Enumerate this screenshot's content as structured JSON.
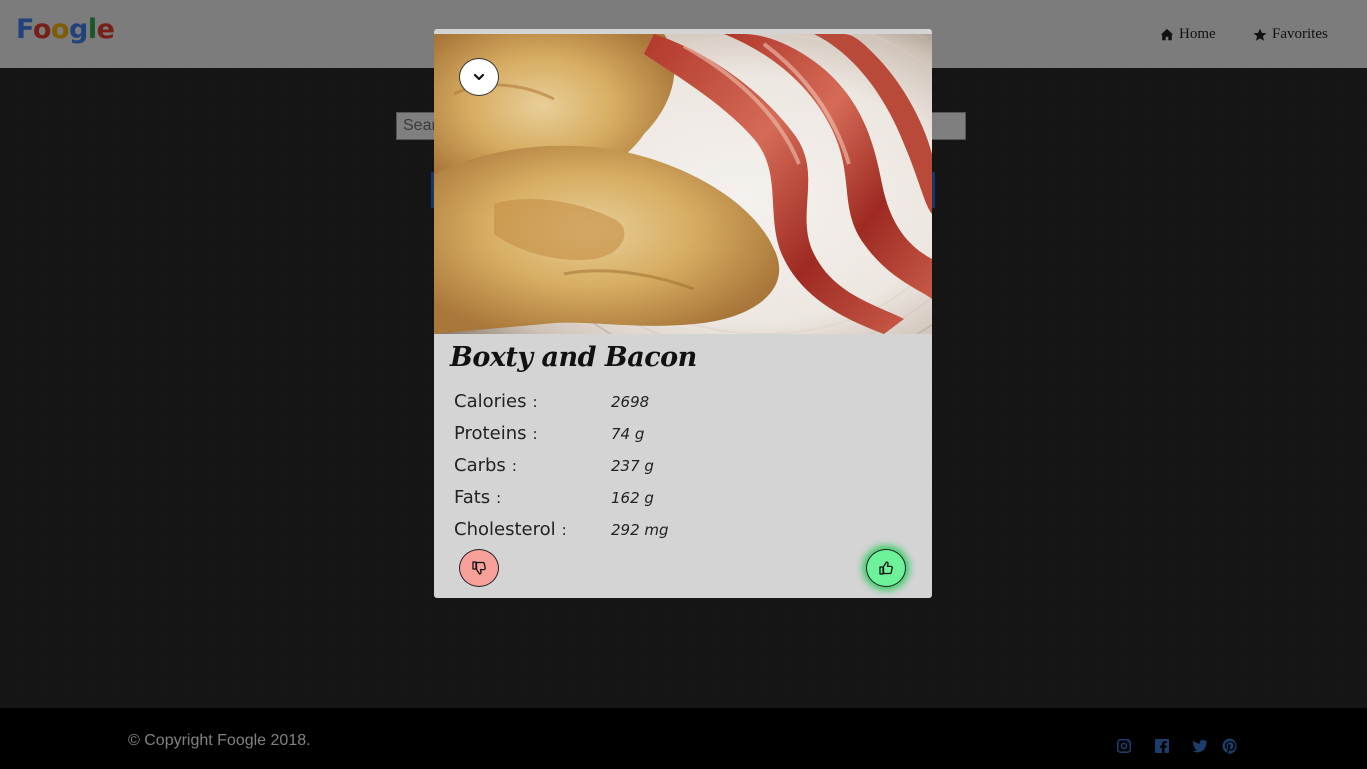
{
  "app": {
    "logo": "Foogle",
    "logo_letters": [
      {
        "char": "F",
        "color": "#4285f4"
      },
      {
        "char": "o",
        "color": "#ea4335"
      },
      {
        "char": "o",
        "color": "#fbbc05"
      },
      {
        "char": "g",
        "color": "#4285f4"
      },
      {
        "char": "l",
        "color": "#34a853"
      },
      {
        "char": "e",
        "color": "#ea4335"
      }
    ]
  },
  "nav": {
    "home": {
      "label": "Home",
      "icon": "home-icon"
    },
    "favorites": {
      "label": "Favorites",
      "icon": "star-icon"
    }
  },
  "search": {
    "placeholder": "Search"
  },
  "modal": {
    "title": "Boxty and Bacon",
    "image_alt": "Boxty and Bacon",
    "collapse_icon": "chevron-down-icon",
    "nutrition": [
      {
        "label": "Calories",
        "value": "2698"
      },
      {
        "label": "Proteins",
        "value": "74 g"
      },
      {
        "label": "Carbs",
        "value": "237 g"
      },
      {
        "label": "Fats",
        "value": "162 g"
      },
      {
        "label": "Cholesterol",
        "value": "292 mg"
      }
    ],
    "colon": ":",
    "dislike_icon": "thumbs-down-icon",
    "like_icon": "thumbs-up-icon"
  },
  "footer": {
    "copyright": "© Copyright Foogle 2018.",
    "social": [
      "instagram-icon",
      "facebook-icon",
      "twitter-icon",
      "pinterest-icon"
    ]
  },
  "colors": {
    "dislike": "#f7a09a",
    "like": "#6df29a",
    "like_glow": "#27c95a",
    "social": "#3a7bd5"
  }
}
